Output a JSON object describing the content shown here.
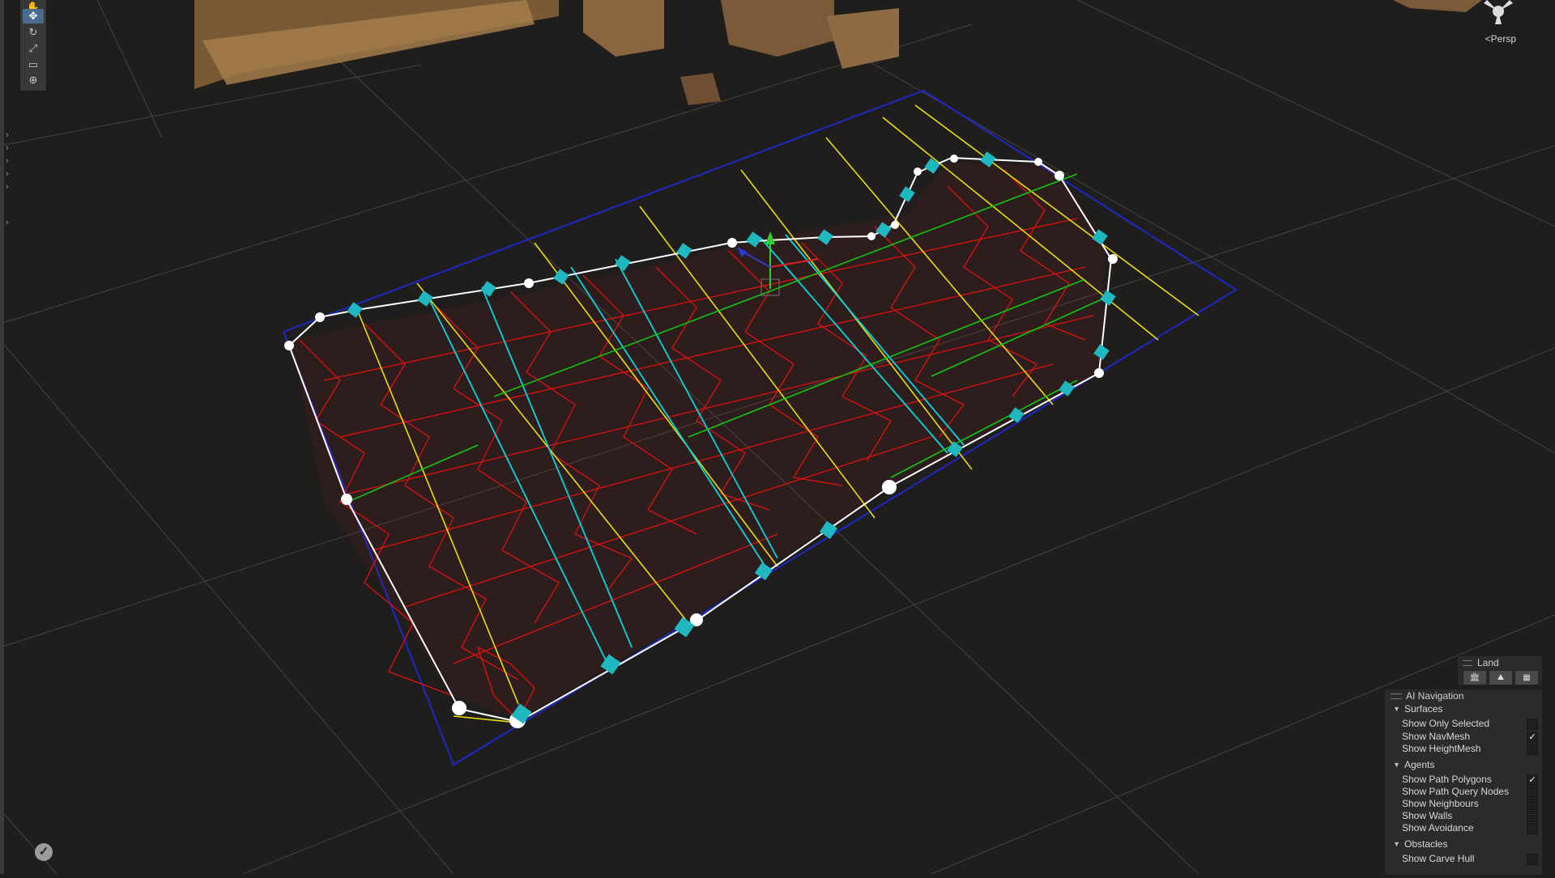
{
  "scene_view": {
    "camera_mode_label": "<Persp",
    "status_icon": "checkmark-icon"
  },
  "toolbar": {
    "tools": [
      {
        "name": "hand-tool-icon",
        "glyph": "✋",
        "active": false
      },
      {
        "name": "move-tool-icon",
        "glyph": "✥",
        "active": true
      },
      {
        "name": "rotate-tool-icon",
        "glyph": "↻",
        "active": false
      },
      {
        "name": "scale-tool-icon",
        "glyph": "⤢",
        "active": false
      },
      {
        "name": "rect-tool-icon",
        "glyph": "▭",
        "active": false
      },
      {
        "name": "transform-tool-icon",
        "glyph": "⊕",
        "active": false
      }
    ]
  },
  "land_overlay": {
    "title": "Land",
    "buttons": [
      "🏛",
      "⛰",
      "▦"
    ]
  },
  "ai_navigation": {
    "title": "AI Navigation",
    "sections": [
      {
        "heading": "Surfaces",
        "options": [
          {
            "label": "Show Only Selected",
            "checked": false
          },
          {
            "label": "Show NavMesh",
            "checked": true
          },
          {
            "label": "Show HeightMesh",
            "checked": false
          }
        ]
      },
      {
        "heading": "Agents",
        "options": [
          {
            "label": "Show Path Polygons",
            "checked": true
          },
          {
            "label": "Show Path Query Nodes",
            "checked": false
          },
          {
            "label": "Show Neighbours",
            "checked": false
          },
          {
            "label": "Show Walls",
            "checked": false
          },
          {
            "label": "Show Avoidance",
            "checked": false
          }
        ]
      },
      {
        "heading": "Obstacles",
        "options": [
          {
            "label": "Show Carve Hull",
            "checked": false
          }
        ]
      }
    ]
  },
  "colors": {
    "background": "#201e1d",
    "grid": "#4a4846",
    "bounds": "#1c28c8",
    "navmesh": "#e01010",
    "spline": "#ffffff",
    "yellow_lines": "#e8e000",
    "cyan_lines": "#00d8e0",
    "green_lines": "#10c810",
    "handles": "#1fb8c0"
  }
}
